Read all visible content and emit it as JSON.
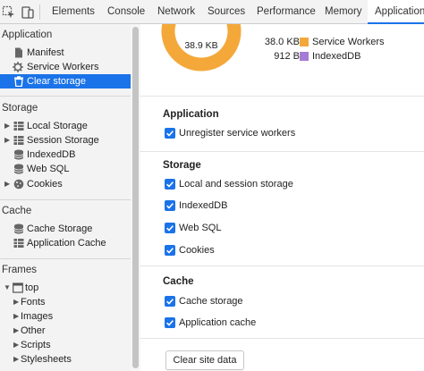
{
  "toolbar": {
    "tabs": [
      {
        "label": "Elements"
      },
      {
        "label": "Console"
      },
      {
        "label": "Network"
      },
      {
        "label": "Sources"
      },
      {
        "label": "Performance"
      },
      {
        "label": "Memory"
      },
      {
        "label": "Application",
        "active": true
      }
    ]
  },
  "sidebar": {
    "application": {
      "title": "Application",
      "items": [
        {
          "label": "Manifest",
          "icon": "document-icon"
        },
        {
          "label": "Service Workers",
          "icon": "gear-icon"
        },
        {
          "label": "Clear storage",
          "icon": "trash-icon",
          "selected": true
        }
      ]
    },
    "storage": {
      "title": "Storage",
      "items": [
        {
          "label": "Local Storage",
          "icon": "table-icon"
        },
        {
          "label": "Session Storage",
          "icon": "table-icon"
        },
        {
          "label": "IndexedDB",
          "icon": "database-icon"
        },
        {
          "label": "Web SQL",
          "icon": "database-icon"
        },
        {
          "label": "Cookies",
          "icon": "cookie-icon"
        }
      ]
    },
    "cache": {
      "title": "Cache",
      "items": [
        {
          "label": "Cache Storage",
          "icon": "database-icon"
        },
        {
          "label": "Application Cache",
          "icon": "table-icon"
        }
      ]
    },
    "frames": {
      "title": "Frames",
      "top": {
        "label": "top",
        "icon": "frame-icon"
      },
      "children": [
        {
          "label": "Fonts"
        },
        {
          "label": "Images"
        },
        {
          "label": "Other"
        },
        {
          "label": "Scripts"
        },
        {
          "label": "Stylesheets"
        }
      ]
    }
  },
  "usage": {
    "total": "38.9 KB",
    "legend": [
      {
        "value": "38.0 KB",
        "name": "Service Workers",
        "color": "#f4a83a"
      },
      {
        "value": "912 B",
        "name": "IndexedDB",
        "color": "#a57bd6"
      }
    ],
    "chart_data": {
      "type": "pie",
      "categories": [
        "Service Workers",
        "IndexedDB"
      ],
      "values": [
        38.0,
        0.912
      ],
      "title": "38.9 KB",
      "xlabel": "",
      "ylabel": ""
    }
  },
  "sections": {
    "application": {
      "title": "Application",
      "options": [
        {
          "label": "Unregister service workers",
          "checked": true
        }
      ]
    },
    "storage": {
      "title": "Storage",
      "options": [
        {
          "label": "Local and session storage",
          "checked": true
        },
        {
          "label": "IndexedDB",
          "checked": true
        },
        {
          "label": "Web SQL",
          "checked": true
        },
        {
          "label": "Cookies",
          "checked": true
        }
      ]
    },
    "cache": {
      "title": "Cache",
      "options": [
        {
          "label": "Cache storage",
          "checked": true
        },
        {
          "label": "Application cache",
          "checked": true
        }
      ]
    }
  },
  "actions": {
    "clear_label": "Clear site data"
  },
  "colors": {
    "accent": "#1a73e8",
    "service_workers": "#f4a83a",
    "indexeddb": "#a57bd6"
  }
}
